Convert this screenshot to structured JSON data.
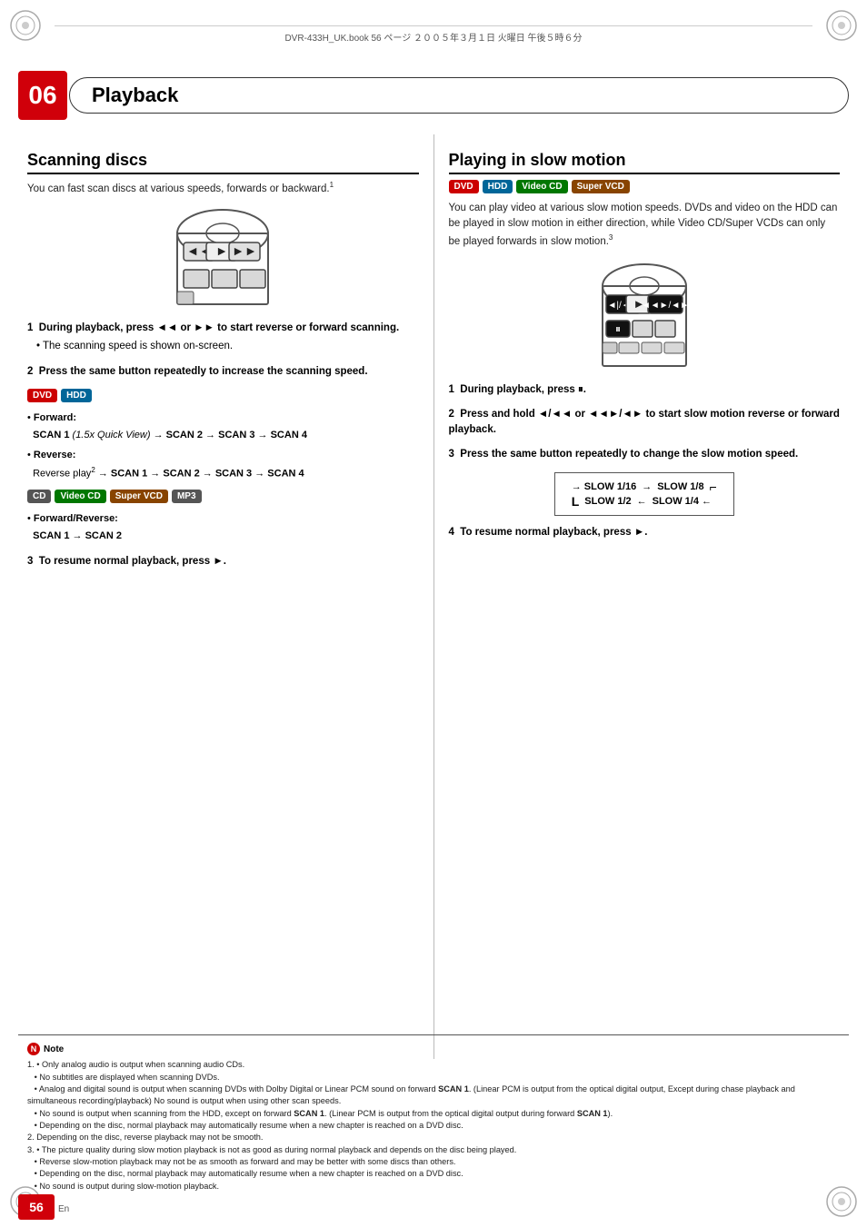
{
  "page": {
    "chapter": "06",
    "title": "Playback",
    "page_number": "56",
    "page_lang": "En",
    "file_info": "DVR-433H_UK.book  56 ページ  ２００５年３月１日  火曜日  午後５時６分"
  },
  "scanning_discs": {
    "heading": "Scanning discs",
    "intro": "You can fast scan discs at various speeds, forwards or backward.",
    "intro_sup": "1",
    "step1_label": "1",
    "step1_bold": "During playback, press ◄◄ or ►► to start reverse or forward scanning.",
    "step1_bullet": "The scanning speed is shown on-screen.",
    "step2_label": "2",
    "step2_bold": "Press the same button repeatedly to increase the scanning speed.",
    "dvd_hdd_badges": [
      "DVD",
      "HDD"
    ],
    "forward_label": "Forward:",
    "forward_text": "SCAN 1",
    "forward_italic": "(1.5x Quick View)",
    "forward_arrow1": "→ SCAN 2 → SCAN 3 → SCAN 4",
    "reverse_label": "Reverse:",
    "reverse_text": "Reverse play",
    "reverse_sup": "2",
    "reverse_arrow": "→ SCAN 1 → SCAN 2 → SCAN 3 → SCAN 4",
    "cd_badges": [
      "CD",
      "Video CD",
      "Super VCD",
      "MP3"
    ],
    "fwd_rev_label": "Forward/Reverse:",
    "fwd_rev_text": "SCAN 1 → SCAN 2",
    "step3_label": "3",
    "step3_bold": "To resume normal playback, press ►."
  },
  "slow_motion": {
    "heading": "Playing in slow motion",
    "badges": [
      "DVD",
      "HDD",
      "Video CD",
      "Super VCD"
    ],
    "intro": "You can play video at various slow motion speeds. DVDs and video on the HDD can be played in slow motion in either direction, while Video CD/Super VCDs can only be played forwards in slow motion.",
    "intro_sup": "3",
    "step1_label": "1",
    "step1_text": "During playback, press",
    "step1_icon": "⏸",
    "step2_label": "2",
    "step2_bold": "Press and hold ◄/◄◄ or ◄◄►/◄► to start slow motion reverse or forward playback.",
    "step3_label": "3",
    "step3_bold": "Press the same button repeatedly to change the slow motion speed.",
    "slow_speeds": {
      "top_left": "SLOW 1/16",
      "arrow_r": "→",
      "top_right": "SLOW 1/8",
      "bottom_left": "SLOW 1/2",
      "arrow_l": "←",
      "bottom_right": "SLOW 1/4"
    },
    "step4_label": "4",
    "step4_text": "To resume normal playback, press ►."
  },
  "notes": {
    "heading": "Note",
    "items": [
      "1. • Only analog audio is output when scanning audio CDs.",
      "   • No subtitles are displayed when scanning DVDs.",
      "   • Analog and digital sound is output when scanning DVDs with Dolby Digital or Linear PCM sound on forward SCAN 1. (Linear PCM is output from the optical digital output, Except during chase playback and simultaneous recording/playback) No sound is output when using other scan speeds.",
      "   • No sound is output when scanning from the HDD, except on forward SCAN 1. (Linear PCM is output from the optical digital output during forward SCAN 1).",
      "   • Depending on the disc, normal playback may automatically resume when a new chapter is reached on a DVD disc.",
      "2. Depending on the disc, reverse playback may not be smooth.",
      "3. • The picture quality during slow motion playback is not as good as during normal playback and depends on the disc being played.",
      "   • Reverse slow-motion playback may not be as smooth as forward and may be better with some discs than others.",
      "   • Depending on the disc, normal playback may automatically resume when a new chapter is reached on a DVD disc.",
      "   • No sound is output during slow-motion playback."
    ]
  }
}
